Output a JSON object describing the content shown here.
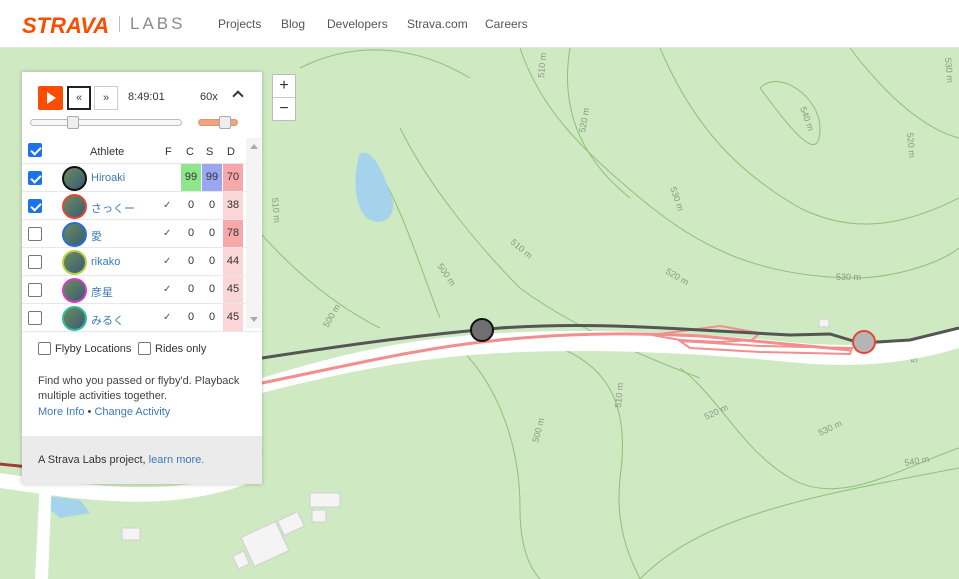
{
  "header": {
    "brand": "STRAVA",
    "sub": "LABS",
    "nav": [
      "Projects",
      "Blog",
      "Developers",
      "Strava.com",
      "Careers"
    ]
  },
  "map": {
    "contours": [
      "510 m",
      "520 m",
      "530 m",
      "540 m",
      "520 m",
      "510 m",
      "500 m",
      "510 m",
      "520 m",
      "530 m",
      "510 m",
      "500 m",
      "500 m",
      "510 m",
      "520 m",
      "530 m",
      "540 m",
      "530 m"
    ],
    "zoom_in": "+",
    "zoom_out": "−"
  },
  "player": {
    "rewind": "«",
    "forward": "»",
    "time": "8:49:01",
    "speed": "60x",
    "progress": 0.27,
    "speed_level": 0.65
  },
  "table": {
    "headers": {
      "athlete": "Athlete",
      "f": "F",
      "c": "C",
      "s": "S",
      "d": "D"
    },
    "rows": [
      {
        "name": "Hiroaki",
        "f": "",
        "c": "99",
        "s": "99",
        "d": "70",
        "checked": true,
        "ring": "#111111"
      },
      {
        "name": "さっくー",
        "f": "✓",
        "c": "0",
        "s": "0",
        "d": "38",
        "checked": true,
        "ring": "#e8433a"
      },
      {
        "name": "愛",
        "f": "✓",
        "c": "0",
        "s": "0",
        "d": "78",
        "checked": false,
        "ring": "#2a6dd8"
      },
      {
        "name": "rikako",
        "f": "✓",
        "c": "0",
        "s": "0",
        "d": "44",
        "checked": false,
        "ring": "#b6d23c"
      },
      {
        "name": "彦星",
        "f": "✓",
        "c": "0",
        "s": "0",
        "d": "45",
        "checked": false,
        "ring": "#d63cc8"
      },
      {
        "name": "みるく",
        "f": "✓",
        "c": "0",
        "s": "0",
        "d": "45",
        "checked": false,
        "ring": "#2fbf9a"
      }
    ]
  },
  "options": {
    "flyby": "Flyby Locations",
    "rides": "Rides only"
  },
  "description": "Find who you passed or flyby'd. Playback multiple activities together.",
  "links": {
    "more": "More Info",
    "sep": "•",
    "change": "Change Activity"
  },
  "footer": {
    "prefix": "A Strava Labs project, ",
    "link": "learn more."
  },
  "colors": {
    "accent": "#fc4c02",
    "c_green": "#8ee68a",
    "s_blue": "#9aa7f0",
    "d_red_dark": "#f7a8a8",
    "d_red_light": "#fbd6d6"
  }
}
